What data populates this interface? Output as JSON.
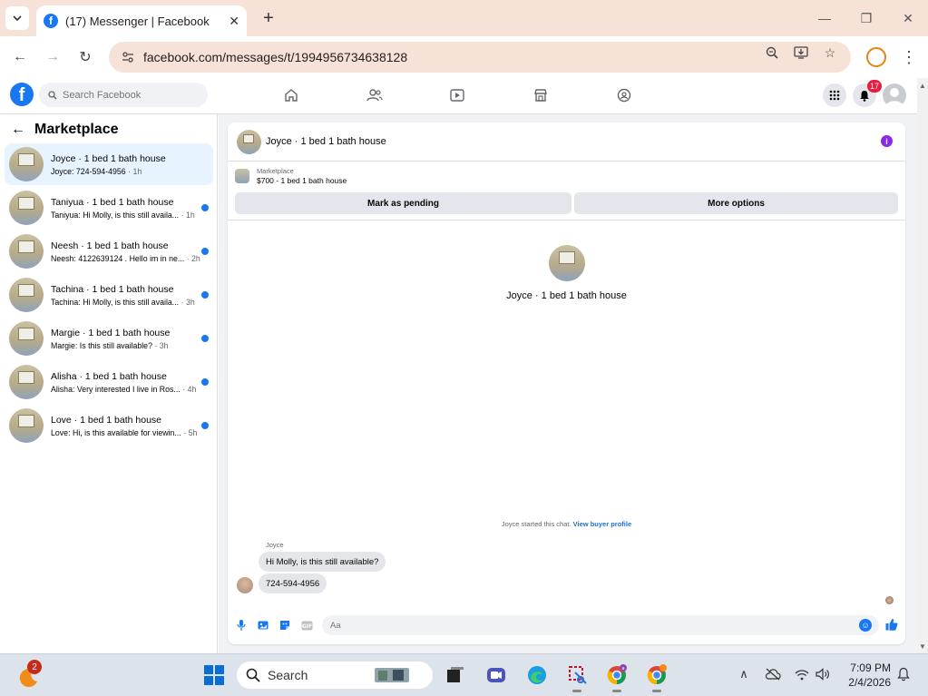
{
  "browser": {
    "tab_title": "(17) Messenger | Facebook",
    "url": "facebook.com/messages/t/1994956734638128"
  },
  "facebook": {
    "search_placeholder": "Search Facebook",
    "notification_count": "17"
  },
  "chat_list": {
    "title": "Marketplace",
    "items": [
      {
        "name": "Joyce · 1 bed 1 bath house",
        "preview": "Joyce: 724-594-4956",
        "time": " · 1h",
        "unread": false,
        "active": true
      },
      {
        "name": "Taniyua · 1 bed 1 bath house",
        "preview": "Taniyua: Hi Molly, is this still availa...",
        "time": " · 1h",
        "unread": true,
        "active": false
      },
      {
        "name": "Neesh · 1 bed 1 bath house",
        "preview": "Neesh: 4122639124 . Hello im in ne...",
        "time": " · 2h",
        "unread": true,
        "active": false
      },
      {
        "name": "Tachina · 1 bed 1 bath house",
        "preview": "Tachina: Hi Molly, is this still availa...",
        "time": " · 3h",
        "unread": true,
        "active": false
      },
      {
        "name": "Margie · 1 bed 1 bath house",
        "preview": "Margie: Is this still available?",
        "time": " · 3h",
        "unread": true,
        "active": false
      },
      {
        "name": "Alisha · 1 bed 1 bath house",
        "preview": "Alisha: Very interested I live in Ros...",
        "time": " · 4h",
        "unread": true,
        "active": false
      },
      {
        "name": "Love · 1 bed 1 bath house",
        "preview": "Love: Hi, is this available for viewin...",
        "time": " · 5h",
        "unread": true,
        "active": false
      }
    ]
  },
  "conversation": {
    "title": "Joyce · 1 bed 1 bath house",
    "marketplace_label": "Marketplace",
    "listing": "$700 - 1 bed 1 bath house",
    "pending_button": "Mark as pending",
    "more_button": "More options",
    "profile_name": "Joyce · 1 bed 1 bath house",
    "started_text": "Joyce started this chat.",
    "view_profile_link": "View buyer profile",
    "sender": "Joyce",
    "messages": [
      "Hi Molly, is this still available?",
      "724-594-4956"
    ],
    "composer_placeholder": "Aa"
  },
  "taskbar": {
    "search_label": "Search",
    "badge_count": "2",
    "time": "7:09 PM",
    "date": "2/4/2026"
  },
  "colors": {
    "facebook_blue": "#1877f2",
    "chrome_tint": "#f7e2d8",
    "active_chat": "#e7f3ff",
    "notification_red": "#e41e3f"
  }
}
